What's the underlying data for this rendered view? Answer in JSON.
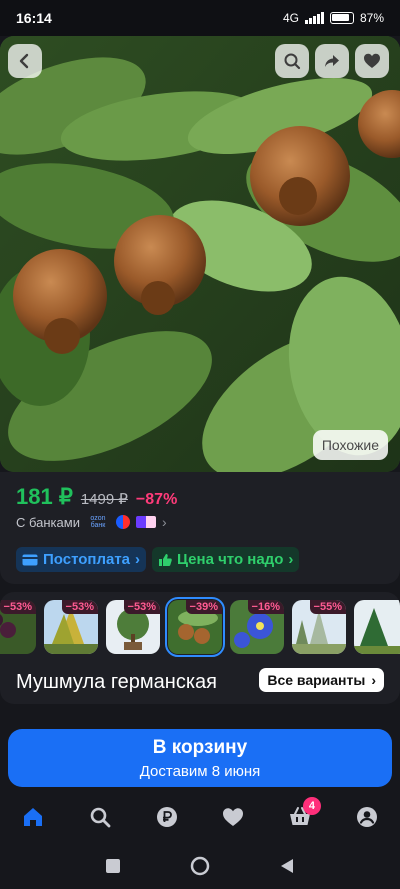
{
  "status": {
    "time": "16:14",
    "network": "4G",
    "battery": "87%"
  },
  "hero": {
    "similar_label": "Похожие",
    "back_icon": "back-icon",
    "search_icon": "search-icon",
    "share_icon": "share-icon",
    "favorite_icon": "heart-icon"
  },
  "price": {
    "current": "181 ₽",
    "old": "1499 ₽",
    "discount": "−87%"
  },
  "banks": {
    "label": "С банками",
    "ozon_text": "ozon банк"
  },
  "chips": {
    "postpay": "Постоплата",
    "fair_price": "Цена что надо"
  },
  "variants": {
    "thumbs": [
      {
        "badge": "−53%"
      },
      {
        "badge": "−53%"
      },
      {
        "badge": "−53%"
      },
      {
        "badge": "−39%",
        "selected": true
      },
      {
        "badge": "−16%"
      },
      {
        "badge": "−55%"
      },
      {
        "badge": ""
      }
    ],
    "product_name": "Мушмула германская",
    "all_variants": "Все варианты"
  },
  "cart": {
    "label": "В корзину",
    "delivery": "Доставим 8 июня"
  },
  "tabbar": {
    "cart_count": "4"
  },
  "colors": {
    "accent": "#1a6ff5",
    "price_green": "#20c05c",
    "discount_pink": "#ff3b7a"
  }
}
